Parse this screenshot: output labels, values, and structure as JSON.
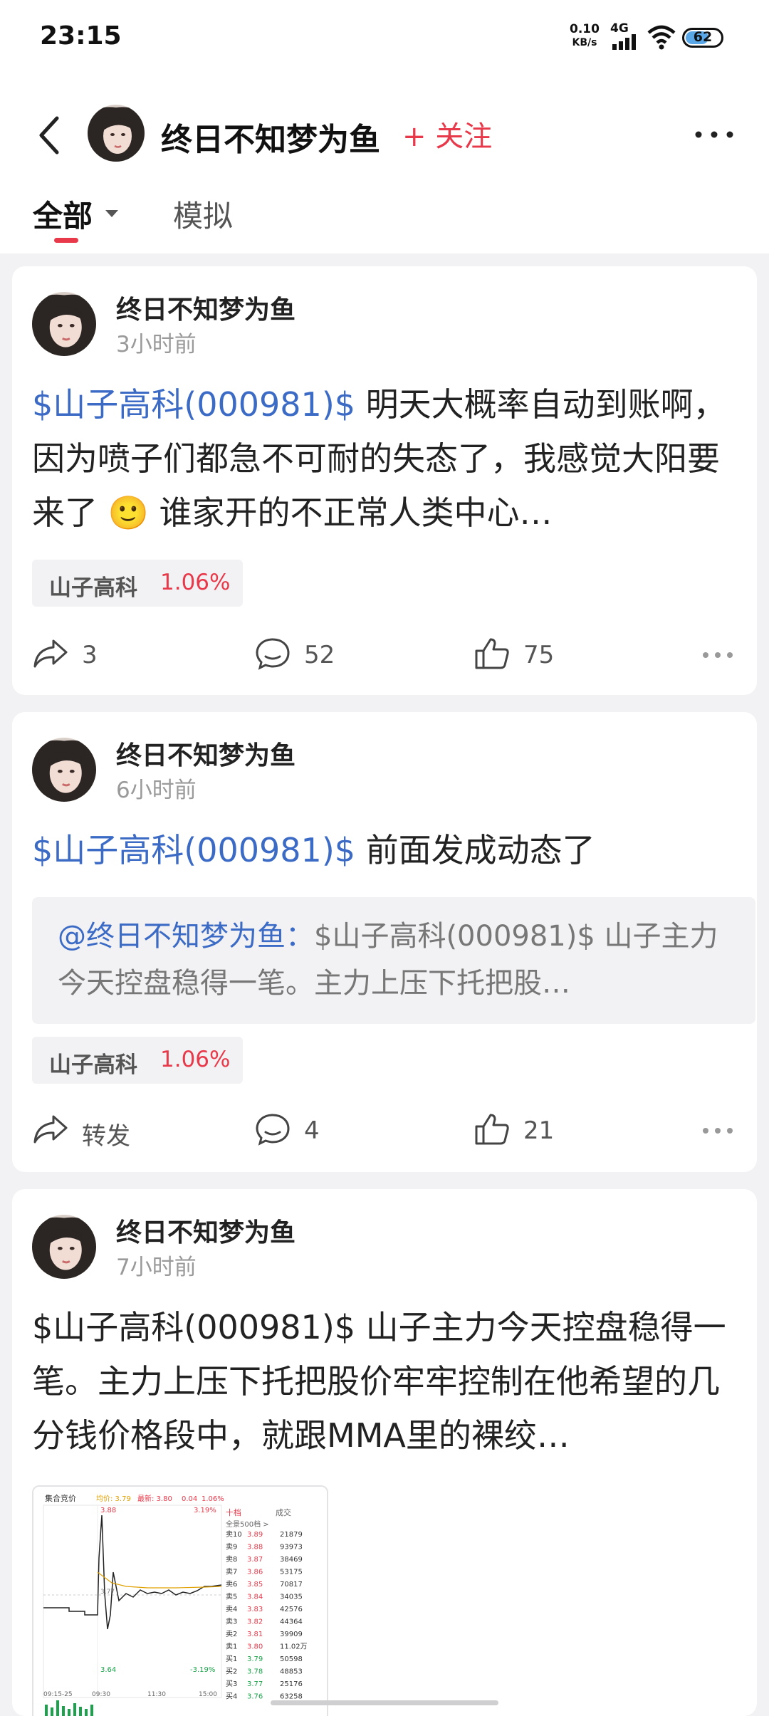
{
  "status_bar": {
    "time": "23:15",
    "net_speed": "0.10",
    "net_unit": "KB/s",
    "signal": "4G",
    "battery": "62"
  },
  "header": {
    "username": "终日不知梦为鱼",
    "follow_label": "+ 关注"
  },
  "tabs": [
    {
      "label": "全部",
      "active": true
    },
    {
      "label": "模拟",
      "active": false
    }
  ],
  "posts": [
    {
      "author": "终日不知梦为鱼",
      "time": "3小时前",
      "stock_link": "$山子高科(000981)$",
      "text": " 明天大概率自动到账啊，因为喷子们都急不可耐的失态了，我感觉大阳要来了",
      "emoji": "🙂",
      "text_tail": "谁家开的不正常人类中心…",
      "tag": {
        "name": "山子高科",
        "pct": "1.06%"
      },
      "shares": "3",
      "comments": "52",
      "likes": "75"
    },
    {
      "author": "终日不知梦为鱼",
      "time": "6小时前",
      "stock_link": "$山子高科(000981)$",
      "text": " 前面发成动态了",
      "quote": {
        "mention": "@终日不知梦为鱼：",
        "body": "$山子高科(000981)$ 山子主力今天控盘稳得一笔。主力上压下托把股…"
      },
      "tag": {
        "name": "山子高科",
        "pct": "1.06%"
      },
      "shares": "转发",
      "comments": "4",
      "likes": "21"
    },
    {
      "author": "终日不知梦为鱼",
      "time": "7小时前",
      "text": "$山子高科(000981)$ 山子主力今天控盘稳得一笔。主力上压下托把股价牢牢控制在他希望的几分钱价格段中，就跟MMA里的裸绞…",
      "image": {
        "title": "集合竞价",
        "avg_label": "均价: 3.79",
        "last_label": "最新: 3.80",
        "change": "0.04",
        "change_pct": "1.06%",
        "high": "3.88",
        "high_pct": "3.19%",
        "low": "3.64",
        "low_pct": "-3.19%",
        "mid": "3.77",
        "times": [
          "09:15-25",
          "09:30",
          "11:30",
          "15:00"
        ],
        "panel_tab": "十档",
        "panel_tab2": "成交",
        "panel_all": "全景500档 >",
        "asks": [
          {
            "label": "卖10",
            "price": "3.89",
            "vol": "21879"
          },
          {
            "label": "卖9",
            "price": "3.88",
            "vol": "93973"
          },
          {
            "label": "卖8",
            "price": "3.87",
            "vol": "38469"
          },
          {
            "label": "卖7",
            "price": "3.86",
            "vol": "53175"
          },
          {
            "label": "卖6",
            "price": "3.85",
            "vol": "70817"
          },
          {
            "label": "卖5",
            "price": "3.84",
            "vol": "34035"
          },
          {
            "label": "卖4",
            "price": "3.83",
            "vol": "42576"
          },
          {
            "label": "卖3",
            "price": "3.82",
            "vol": "44364"
          },
          {
            "label": "卖2",
            "price": "3.81",
            "vol": "39909"
          },
          {
            "label": "卖1",
            "price": "3.80",
            "vol": "11.02万"
          }
        ],
        "bids": [
          {
            "label": "买1",
            "price": "3.79",
            "vol": "50598"
          },
          {
            "label": "买2",
            "price": "3.78",
            "vol": "48853"
          },
          {
            "label": "买3",
            "price": "3.77",
            "vol": "25176"
          },
          {
            "label": "买4",
            "price": "3.76",
            "vol": "63258"
          }
        ]
      }
    }
  ]
}
